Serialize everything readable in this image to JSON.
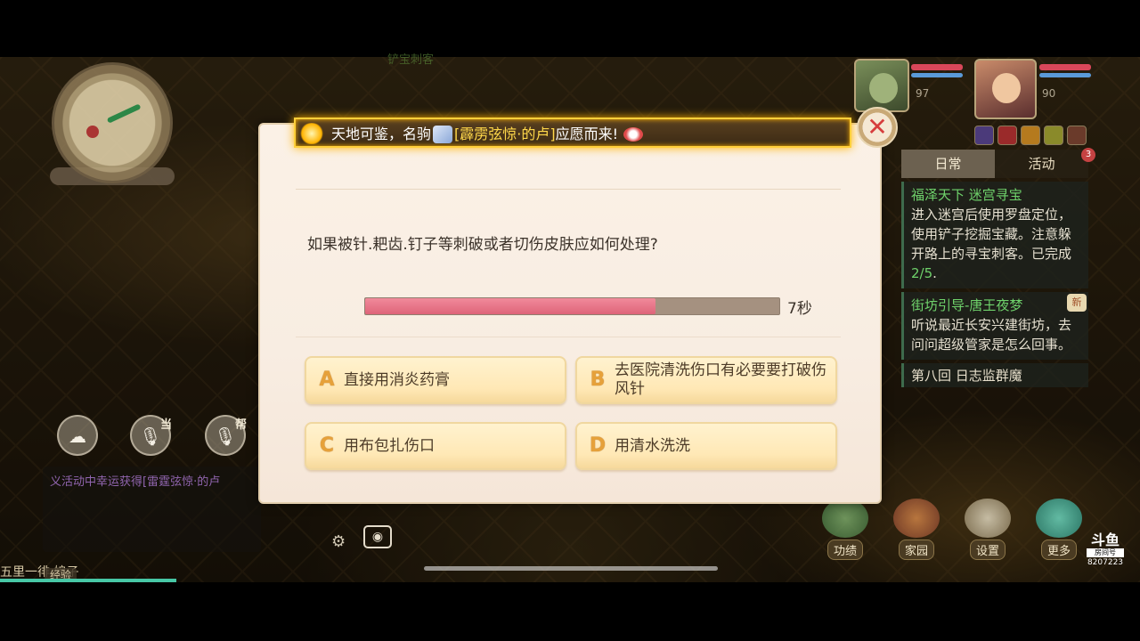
{
  "game_hud": {
    "quest_hint": "铲宝刺客",
    "pet_level": "97",
    "hero_level": "90",
    "tracker": {
      "tabs": [
        {
          "label": "日常",
          "active": true
        },
        {
          "label": "活动",
          "active": false
        }
      ],
      "activity_badge": "3",
      "quests": [
        {
          "title": "福泽天下  迷宫寻宝",
          "description": "进入迷宫后使用罗盘定位，使用铲子挖掘宝藏。注意躲开路上的寻宝刺客。已完成",
          "progress": "2/5",
          "suffix": "."
        },
        {
          "title": "街坊引导-唐王夜梦",
          "description": "听说最近长安兴建街坊，去问问超级管家是怎么回事。",
          "new_badge": "新"
        }
      ],
      "chapter": "第八回 日志监群魔"
    },
    "voice_tags": {
      "team": "当",
      "gang": "帮"
    },
    "chat_line": "义活动中幸运获得[雷霆弦惊·的卢",
    "bottom_text": "五里一徘    娘子",
    "exp_label": "经验",
    "menu": [
      {
        "label": "功绩",
        "icon": "achievement-icon"
      },
      {
        "label": "家园",
        "icon": "home-icon"
      },
      {
        "label": "设置",
        "icon": "settings-icon"
      },
      {
        "label": "更多",
        "icon": "more-icon"
      }
    ],
    "watermark": {
      "logo": "斗鱼",
      "sub": "房间号",
      "room": "8207223"
    }
  },
  "announcement": {
    "prefix": "天地可鉴，名驹",
    "item_name": "[霹雳弦惊·的卢]",
    "suffix": "应愿而来!"
  },
  "quiz": {
    "question": "如果被针.耙齿.钉子等刺破或者切伤皮肤应如何处理?",
    "timer_text": "7秒",
    "timer_fraction": 0.7,
    "options": [
      {
        "letter": "A",
        "text": "直接用消炎药膏"
      },
      {
        "letter": "B",
        "text": "去医院清洗伤口有必要要打破伤风针"
      },
      {
        "letter": "C",
        "text": "用布包扎伤口"
      },
      {
        "letter": "D",
        "text": "用清水洗洗"
      }
    ]
  },
  "colors": {
    "timer_fill": "#de6479",
    "quest_green": "#6fd26b",
    "banner_gold": "#ffd84a",
    "close_red": "#d63d3d"
  }
}
